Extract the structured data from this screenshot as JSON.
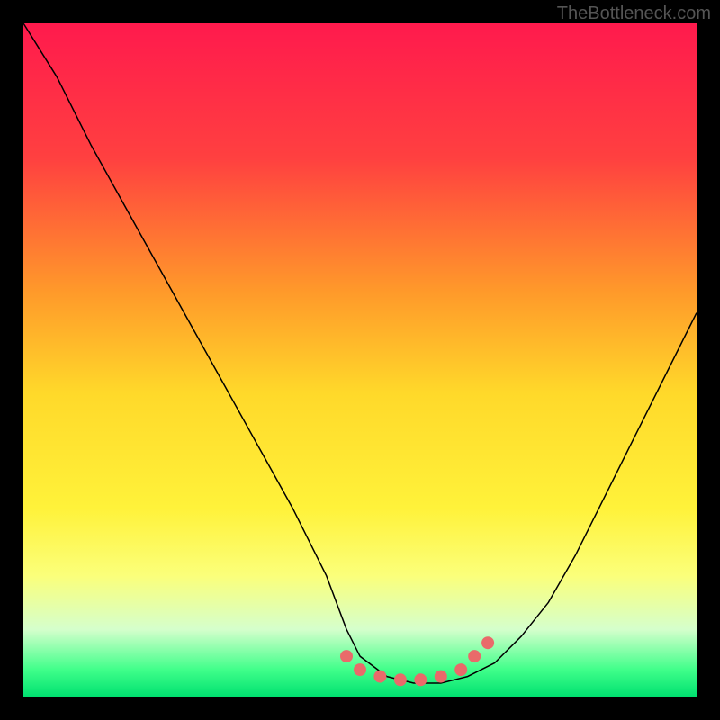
{
  "watermark": "TheBottleneck.com",
  "chart_data": {
    "type": "line",
    "title": "",
    "xlabel": "",
    "ylabel": "",
    "xlim": [
      0,
      100
    ],
    "ylim": [
      0,
      100
    ],
    "background_gradient": {
      "stops": [
        {
          "pct": 0,
          "color": "#ff1a4d"
        },
        {
          "pct": 20,
          "color": "#ff4040"
        },
        {
          "pct": 40,
          "color": "#ff9a2a"
        },
        {
          "pct": 55,
          "color": "#ffd92a"
        },
        {
          "pct": 72,
          "color": "#fff23a"
        },
        {
          "pct": 82,
          "color": "#fbff7a"
        },
        {
          "pct": 90,
          "color": "#d5ffcc"
        },
        {
          "pct": 96,
          "color": "#40ff8a"
        },
        {
          "pct": 100,
          "color": "#00e070"
        }
      ]
    },
    "series": [
      {
        "name": "bottleneck-curve",
        "stroke": "#000000",
        "stroke_width": 1.5,
        "x": [
          0,
          5,
          10,
          15,
          20,
          25,
          30,
          35,
          40,
          45,
          48,
          50,
          54,
          58,
          62,
          66,
          70,
          74,
          78,
          82,
          86,
          90,
          94,
          98,
          100
        ],
        "y": [
          100,
          92,
          82,
          73,
          64,
          55,
          46,
          37,
          28,
          18,
          10,
          6,
          3,
          2,
          2,
          3,
          5,
          9,
          14,
          21,
          29,
          37,
          45,
          53,
          57
        ]
      }
    ],
    "markers": {
      "name": "highlight-points",
      "color": "#e96a6a",
      "radius": 7,
      "x": [
        48,
        50,
        53,
        56,
        59,
        62,
        65,
        67,
        69
      ],
      "y": [
        6,
        4,
        3,
        2.5,
        2.5,
        3,
        4,
        6,
        8
      ]
    }
  }
}
